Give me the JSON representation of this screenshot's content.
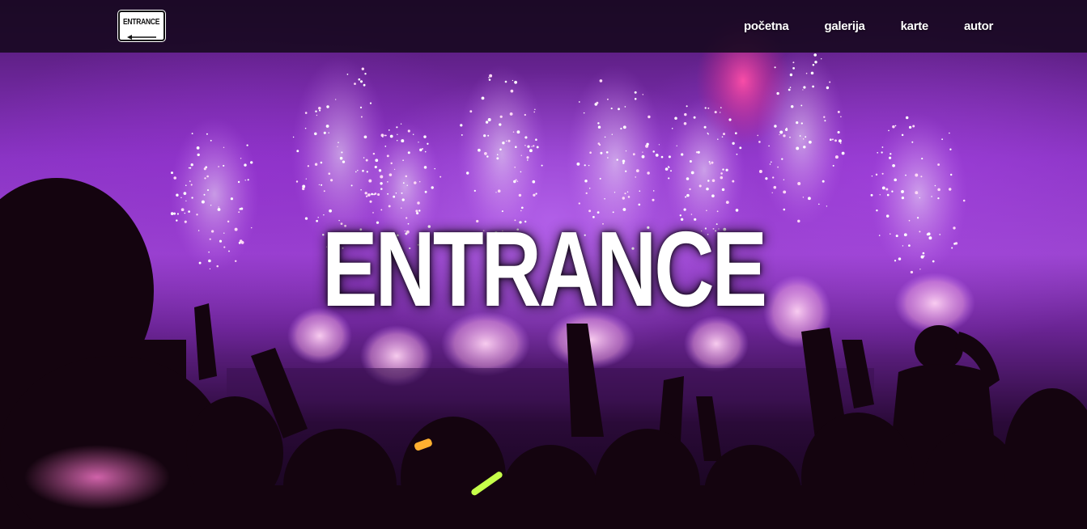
{
  "logo": {
    "text": "ENTRANCE",
    "icon": "arrow-left-icon"
  },
  "nav": {
    "items": [
      {
        "label": "početna",
        "active": true
      },
      {
        "label": "galerija",
        "active": false
      },
      {
        "label": "karte",
        "active": false
      },
      {
        "label": "autor",
        "active": false
      }
    ]
  },
  "hero": {
    "title": "ENTRANCE"
  },
  "colors": {
    "navbar_bg": "#16081e",
    "hero_purple": "#9a45cf",
    "active_indicator": "#d9c6e3",
    "text": "#ffffff"
  }
}
